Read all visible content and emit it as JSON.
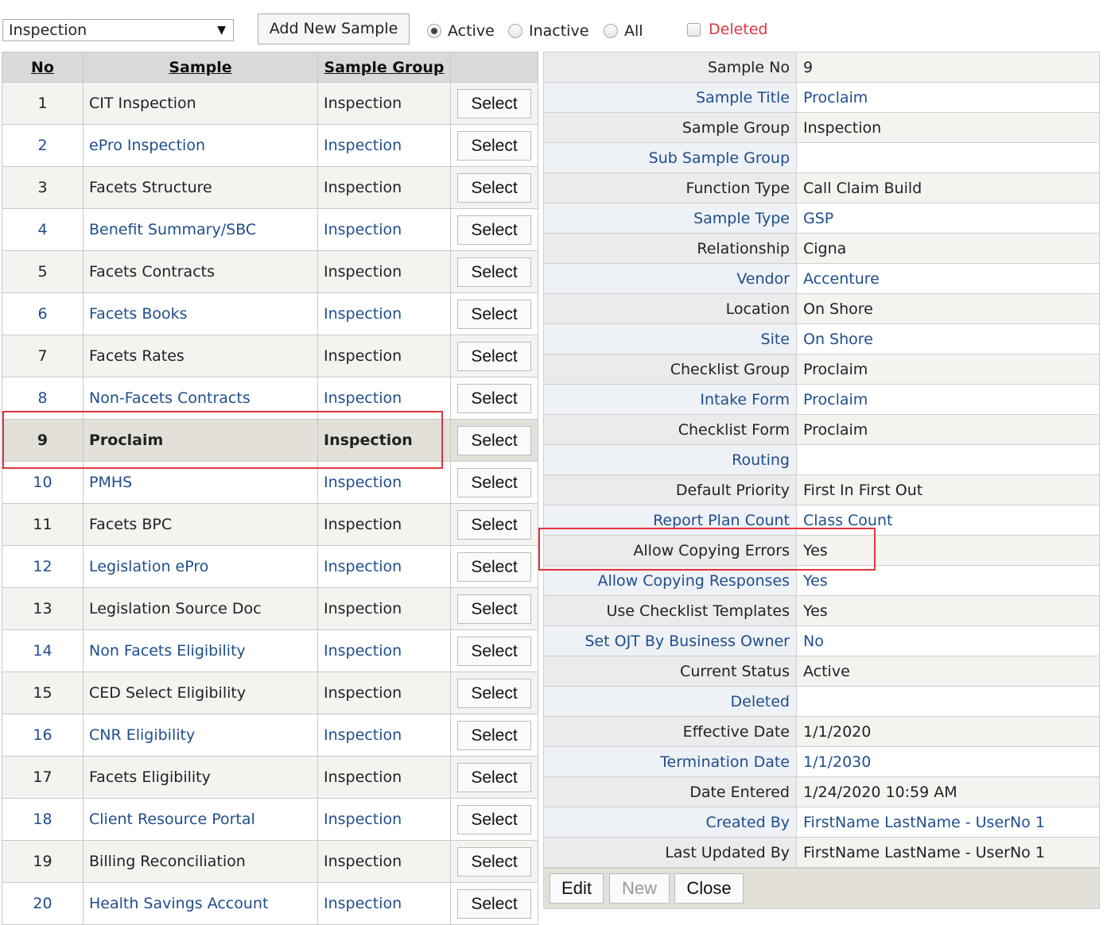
{
  "toolbar": {
    "dropdown_value": "Inspection",
    "add_button": "Add New Sample",
    "radio_active": "Active",
    "radio_inactive": "Inactive",
    "radio_all": "All",
    "checkbox_deleted": "Deleted",
    "selected_radio": "Active",
    "deleted_color": "#e0343d"
  },
  "grid": {
    "headers": {
      "no": "No",
      "sample": "Sample",
      "group": "Sample Group"
    },
    "select_label": "Select",
    "selected_no": 9,
    "rows": [
      {
        "no": "1",
        "sample": "CIT Inspection",
        "group": "Inspection"
      },
      {
        "no": "2",
        "sample": "ePro Inspection",
        "group": "Inspection"
      },
      {
        "no": "3",
        "sample": "Facets Structure",
        "group": "Inspection"
      },
      {
        "no": "4",
        "sample": "Benefit Summary/SBC",
        "group": "Inspection"
      },
      {
        "no": "5",
        "sample": "Facets Contracts",
        "group": "Inspection"
      },
      {
        "no": "6",
        "sample": "Facets Books",
        "group": "Inspection"
      },
      {
        "no": "7",
        "sample": "Facets Rates",
        "group": "Inspection"
      },
      {
        "no": "8",
        "sample": "Non-Facets Contracts",
        "group": "Inspection"
      },
      {
        "no": "9",
        "sample": "Proclaim",
        "group": "Inspection"
      },
      {
        "no": "10",
        "sample": "PMHS",
        "group": "Inspection"
      },
      {
        "no": "11",
        "sample": "Facets BPC",
        "group": "Inspection"
      },
      {
        "no": "12",
        "sample": "Legislation ePro",
        "group": "Inspection"
      },
      {
        "no": "13",
        "sample": "Legislation Source Doc",
        "group": "Inspection"
      },
      {
        "no": "14",
        "sample": "Non Facets Eligibility",
        "group": "Inspection"
      },
      {
        "no": "15",
        "sample": "CED Select Eligibility",
        "group": "Inspection"
      },
      {
        "no": "16",
        "sample": "CNR Eligibility",
        "group": "Inspection"
      },
      {
        "no": "17",
        "sample": "Facets Eligibility",
        "group": "Inspection"
      },
      {
        "no": "18",
        "sample": "Client Resource Portal",
        "group": "Inspection"
      },
      {
        "no": "19",
        "sample": "Billing Reconciliation",
        "group": "Inspection"
      },
      {
        "no": "20",
        "sample": "Health Savings Account",
        "group": "Inspection"
      }
    ]
  },
  "detail": {
    "fields": [
      {
        "label": "Sample No",
        "value": "9"
      },
      {
        "label": "Sample Title",
        "value": "Proclaim"
      },
      {
        "label": "Sample Group",
        "value": "Inspection"
      },
      {
        "label": "Sub Sample Group",
        "value": ""
      },
      {
        "label": "Function Type",
        "value": "Call Claim Build"
      },
      {
        "label": "Sample Type",
        "value": "GSP"
      },
      {
        "label": "Relationship",
        "value": "Cigna"
      },
      {
        "label": "Vendor",
        "value": "Accenture"
      },
      {
        "label": "Location",
        "value": "On Shore"
      },
      {
        "label": "Site",
        "value": "On Shore"
      },
      {
        "label": "Checklist Group",
        "value": "Proclaim"
      },
      {
        "label": "Intake Form",
        "value": "Proclaim"
      },
      {
        "label": "Checklist Form",
        "value": "Proclaim"
      },
      {
        "label": "Routing",
        "value": ""
      },
      {
        "label": "Default Priority",
        "value": "First In First Out"
      },
      {
        "label": "Report Plan Count",
        "value": "Class Count"
      },
      {
        "label": "Allow Copying Errors",
        "value": "Yes"
      },
      {
        "label": "Allow Copying Responses",
        "value": "Yes"
      },
      {
        "label": "Use Checklist Templates",
        "value": "Yes"
      },
      {
        "label": "Set OJT By Business Owner",
        "value": "No"
      },
      {
        "label": "Current Status",
        "value": "Active"
      },
      {
        "label": "Deleted",
        "value": ""
      },
      {
        "label": "Effective Date",
        "value": "1/1/2020"
      },
      {
        "label": "Termination Date",
        "value": "1/1/2030"
      },
      {
        "label": "Date Entered",
        "value": "1/24/2020 10:59 AM"
      },
      {
        "label": "Created By",
        "value": "FirstName LastName - UserNo 1"
      },
      {
        "label": "Last Updated By",
        "value": "FirstName LastName - UserNo 1"
      }
    ],
    "buttons": {
      "edit": "Edit",
      "new": "New",
      "close": "Close"
    },
    "new_disabled": true
  },
  "highlight_color": "#e0343d"
}
